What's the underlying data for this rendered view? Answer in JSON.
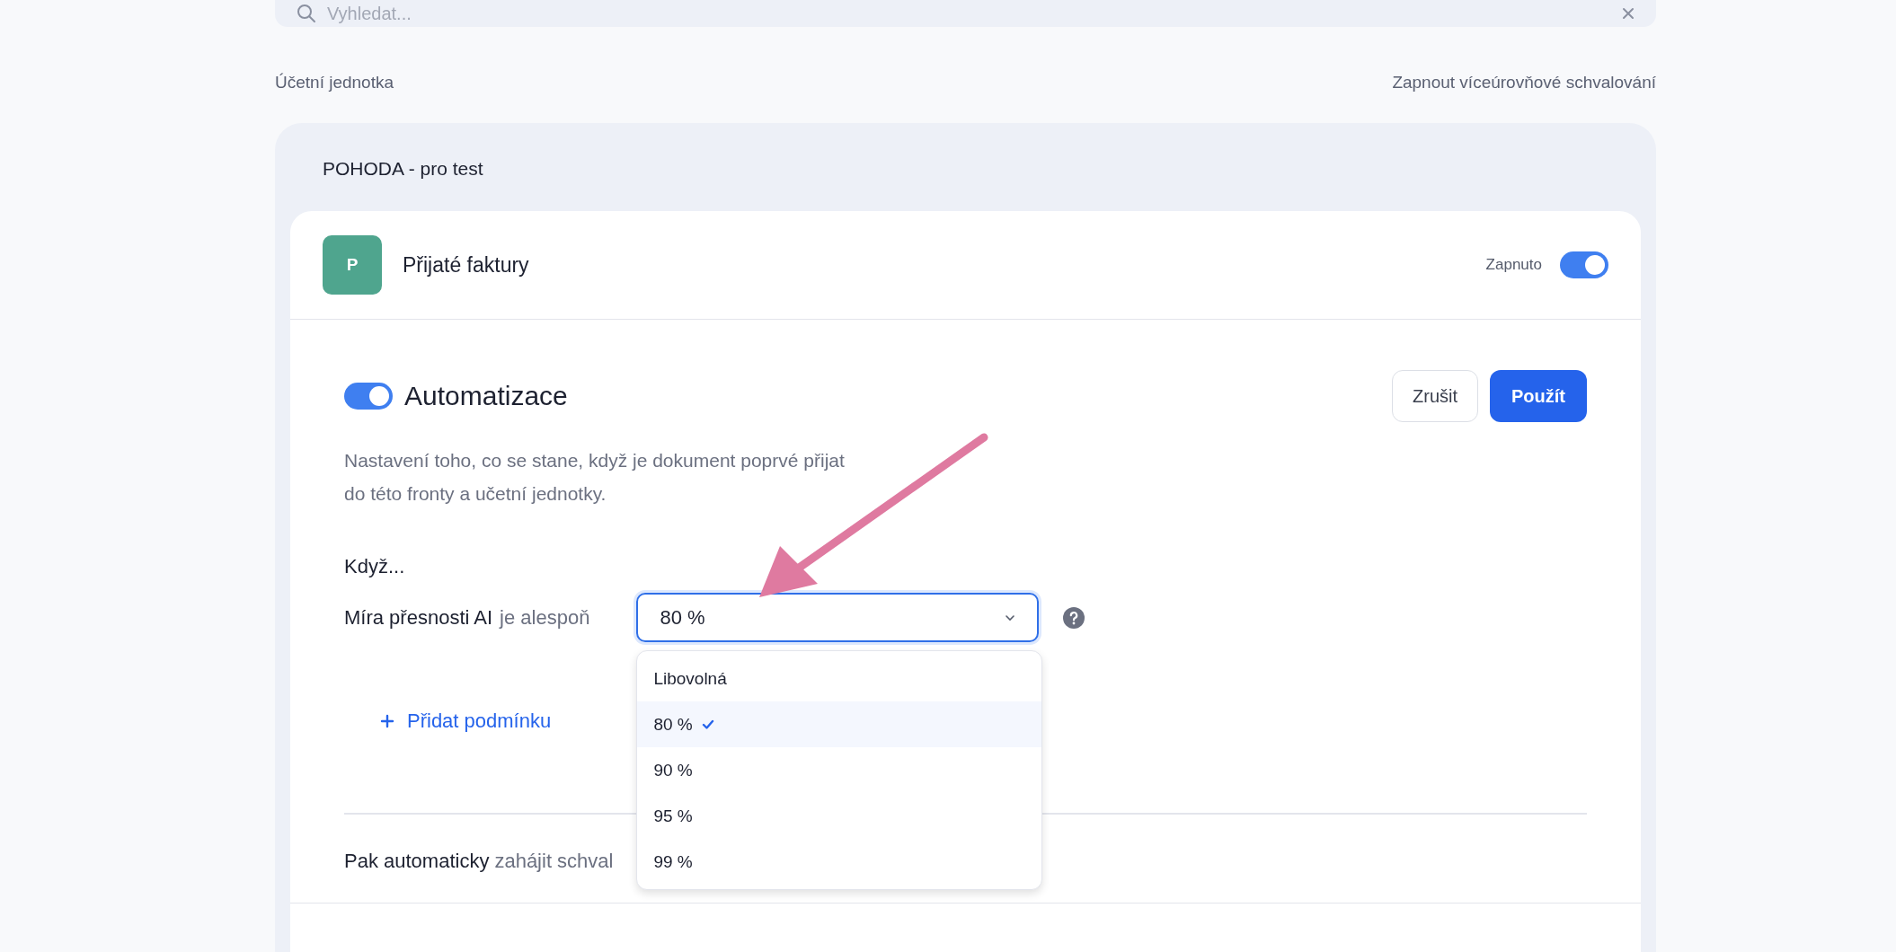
{
  "search": {
    "placeholder": "Vyhledat..."
  },
  "header": {
    "label": "Účetní jednotka",
    "link": "Zapnout víceúrovňové schvalování"
  },
  "unit": {
    "name": "POHODA - pro test",
    "queue": {
      "avatar": "P",
      "title": "Přijaté faktury",
      "status_label": "Zapnuto",
      "enabled": true
    },
    "automation": {
      "enabled": true,
      "title": "Automatizace",
      "description": "Nastavení toho, co se stane, když je dokument poprvé přijat do této fronty a učetní jednotky.",
      "buttons": [
        {
          "label": "Zrušit",
          "kind": "secondary"
        },
        {
          "label": "Použít",
          "kind": "primary"
        }
      ],
      "when_label": "Když...",
      "condition": {
        "field": "Míra přesnosti AI",
        "operator": "je alespoň",
        "value": "80 %",
        "expanded": true,
        "options": [
          {
            "label": "Libovolná",
            "selected": false
          },
          {
            "label": "80 %",
            "selected": true
          },
          {
            "label": "90 %",
            "selected": false
          },
          {
            "label": "95 %",
            "selected": false
          },
          {
            "label": "99 %",
            "selected": false
          }
        ]
      },
      "add_condition": "Přidat podmínku",
      "then": {
        "lead": "Pak automaticky",
        "rest": "zahájit schval"
      }
    }
  }
}
